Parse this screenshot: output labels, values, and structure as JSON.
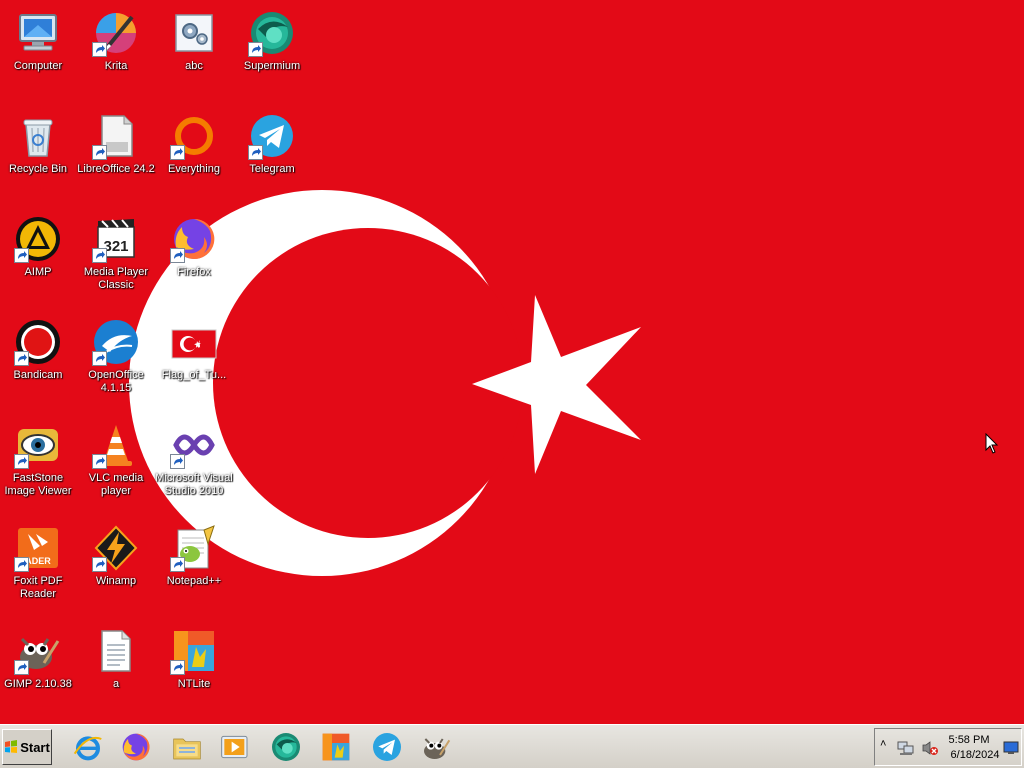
{
  "colors": {
    "wallpaper_red": "#e30a17",
    "taskbar": "#d4d0c8"
  },
  "desktop": {
    "icons": [
      {
        "key": "computer",
        "label": "Computer",
        "icon": "computer-icon",
        "shortcut": false
      },
      {
        "key": "recycle",
        "label": "Recycle Bin",
        "icon": "recycle-bin-icon",
        "shortcut": false
      },
      {
        "key": "aimp",
        "label": "AIMP",
        "icon": "aimp-icon",
        "shortcut": true
      },
      {
        "key": "bandicam",
        "label": "Bandicam",
        "icon": "bandicam-icon",
        "shortcut": true
      },
      {
        "key": "faststone",
        "label": "FastStone Image Viewer",
        "icon": "faststone-icon",
        "shortcut": true
      },
      {
        "key": "foxit",
        "label": "Foxit PDF Reader",
        "icon": "foxit-icon",
        "shortcut": true
      },
      {
        "key": "gimp",
        "label": "GIMP 2.10.38",
        "icon": "gimp-icon",
        "shortcut": true
      },
      {
        "key": "krita",
        "label": "Krita",
        "icon": "krita-icon",
        "shortcut": true
      },
      {
        "key": "libreoffice",
        "label": "LibreOffice 24.2",
        "icon": "libreoffice-icon",
        "shortcut": true
      },
      {
        "key": "mpc",
        "label": "Media Player Classic",
        "icon": "media-player-classic-icon",
        "shortcut": true
      },
      {
        "key": "openoffice",
        "label": "OpenOffice 4.1.15",
        "icon": "openoffice-icon",
        "shortcut": true
      },
      {
        "key": "vlc",
        "label": "VLC media player",
        "icon": "vlc-icon",
        "shortcut": true
      },
      {
        "key": "winamp",
        "label": "Winamp",
        "icon": "winamp-icon",
        "shortcut": true
      },
      {
        "key": "a",
        "label": "a",
        "icon": "text-file-icon",
        "shortcut": false
      },
      {
        "key": "abc",
        "label": "abc",
        "icon": "settings-file-icon",
        "shortcut": false
      },
      {
        "key": "everything",
        "label": "Everything",
        "icon": "everything-icon",
        "shortcut": true
      },
      {
        "key": "firefox",
        "label": "Firefox",
        "icon": "firefox-icon",
        "shortcut": true
      },
      {
        "key": "flag",
        "label": "Flag_of_Tu...",
        "icon": "flag-image-icon",
        "shortcut": false
      },
      {
        "key": "vstudio",
        "label": "Microsoft Visual Studio 2010",
        "icon": "visual-studio-icon",
        "shortcut": true
      },
      {
        "key": "notepadpp",
        "label": "Notepad++",
        "icon": "notepad-plus-plus-icon",
        "shortcut": true
      },
      {
        "key": "ntlite",
        "label": "NTLite",
        "icon": "ntlite-icon",
        "shortcut": true
      },
      {
        "key": "supermium",
        "label": "Supermium",
        "icon": "supermium-icon",
        "shortcut": true
      },
      {
        "key": "telegram",
        "label": "Telegram",
        "icon": "telegram-icon",
        "shortcut": true
      }
    ]
  },
  "taskbar": {
    "start_label": "Start",
    "pinned": [
      {
        "key": "ie",
        "icon": "internet-explorer-icon"
      },
      {
        "key": "firefox",
        "icon": "firefox-icon"
      },
      {
        "key": "explorer",
        "icon": "file-explorer-icon"
      },
      {
        "key": "mediaplayer",
        "icon": "media-player-icon"
      },
      {
        "key": "supermium",
        "icon": "supermium-icon"
      },
      {
        "key": "ntlite",
        "icon": "ntlite-icon"
      },
      {
        "key": "telegram",
        "icon": "telegram-icon"
      },
      {
        "key": "gimp",
        "icon": "gimp-icon"
      }
    ],
    "tray": {
      "expand_glyph": "˄",
      "network_icon": "network-icon",
      "volume_icon": "volume-muted-icon",
      "time": "5:58 PM",
      "date": "6/18/2024"
    }
  }
}
